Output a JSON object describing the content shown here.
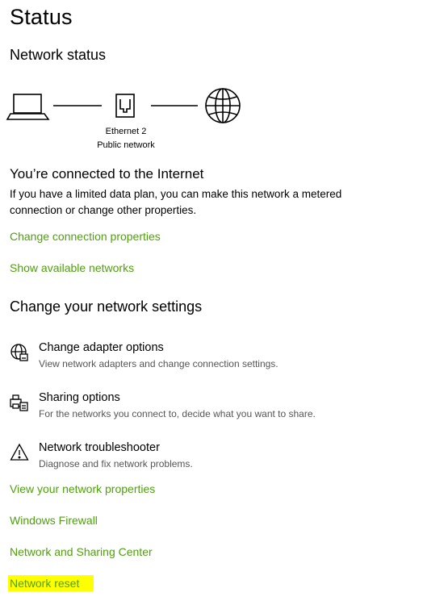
{
  "page": {
    "title": "Status"
  },
  "network_status": {
    "heading": "Network status",
    "adapter_name": "Ethernet 2",
    "network_type": "Public network",
    "icons": [
      "laptop-icon",
      "ethernet-icon",
      "globe-icon"
    ]
  },
  "connection": {
    "heading": "You’re connected to the Internet",
    "description": "If you have a limited data plan, you can make this network a metered connection or change other properties.",
    "links": {
      "change_connection": "Change connection properties",
      "show_networks": "Show available networks"
    }
  },
  "change_settings": {
    "heading": "Change your network settings",
    "options": [
      {
        "icon": "adapter-globe-icon",
        "title": "Change adapter options",
        "description": "View network adapters and change connection settings."
      },
      {
        "icon": "printer-share-icon",
        "title": "Sharing options",
        "description": "For the networks you connect to, decide what you want to share."
      },
      {
        "icon": "warning-icon",
        "title": "Network troubleshooter",
        "description": "Diagnose and fix network problems."
      }
    ]
  },
  "bottom_links": {
    "view_properties": "View your network properties",
    "firewall": "Windows Firewall",
    "sharing_center": "Network and Sharing Center",
    "reset": "Network reset"
  },
  "colors": {
    "link": "#4ea10a",
    "highlight": "#ffff00",
    "text": "#000000",
    "secondary": "#555555"
  }
}
